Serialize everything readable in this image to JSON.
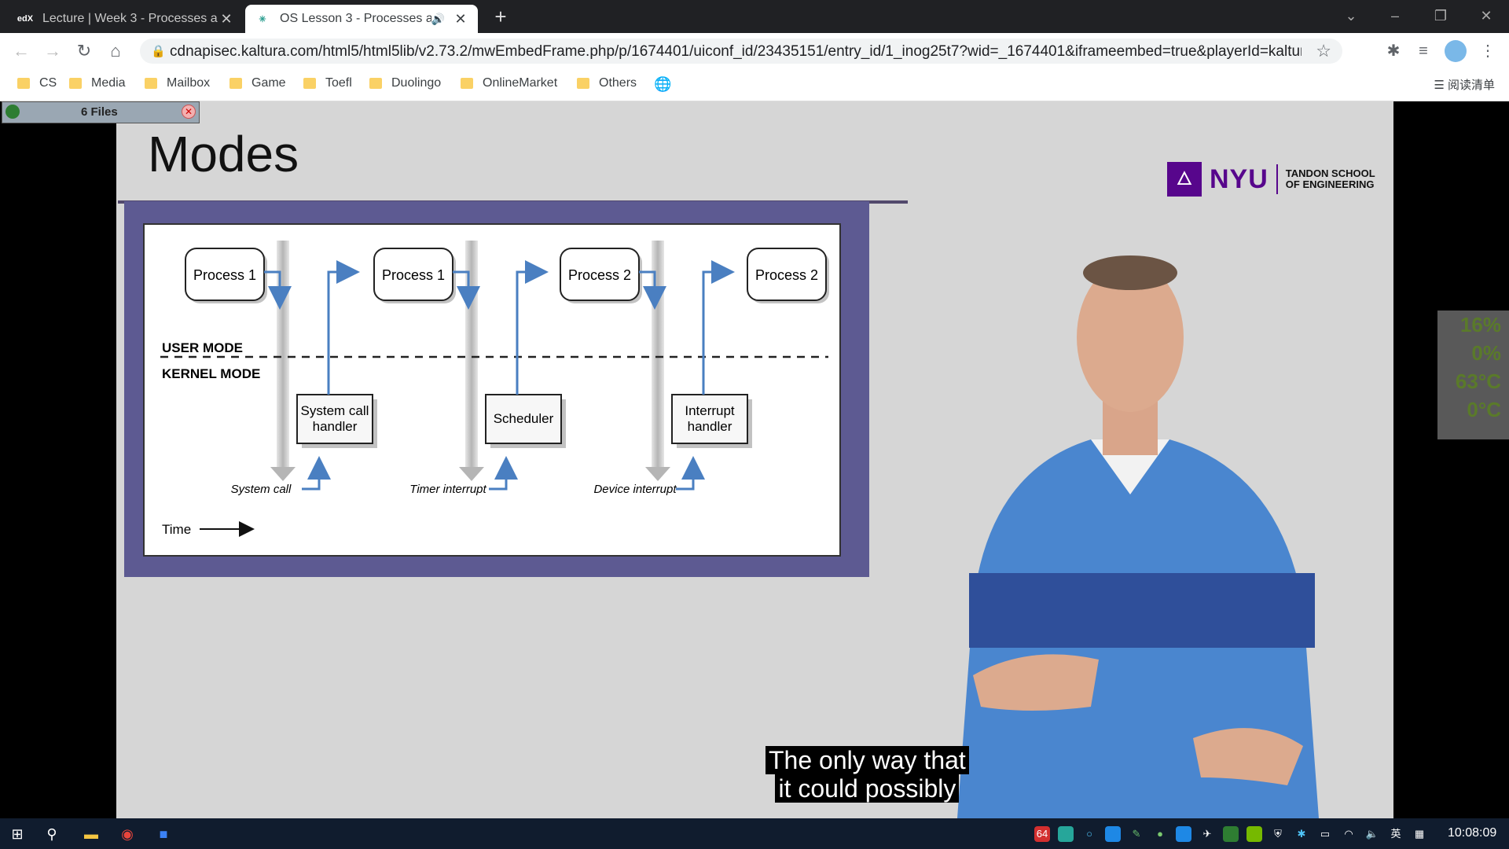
{
  "browser": {
    "tabs": [
      {
        "title": "Lecture | Week 3 - Processes a",
        "favicon": "edx-icon",
        "active": false
      },
      {
        "title": "OS Lesson 3 - Processes a",
        "favicon": "kaltura-icon",
        "active": true,
        "audio": true
      }
    ],
    "url": "cdnapisec.kaltura.com/html5/html5lib/v2.73.2/mwEmbedFrame.php/p/1674401/uiconf_id/23435151/entry_id/1_inog25t7?wid=_1674401&iframeembed=true&playerId=kaltur...",
    "bookmarks": [
      "CS",
      "Media",
      "Mailbox",
      "Game",
      "Toefl",
      "Duolingo",
      "OnlineMarket",
      "Others"
    ],
    "reading_list": "阅读清单"
  },
  "overlay": {
    "files_label": "6 Files"
  },
  "slide": {
    "title": "Modes",
    "logo": {
      "name": "NYU",
      "line1": "TANDON SCHOOL",
      "line2": "OF ENGINEERING"
    },
    "diagram": {
      "processes": [
        "Process 1",
        "Process 1",
        "Process 2",
        "Process 2"
      ],
      "mode_user": "USER MODE",
      "mode_kernel": "KERNEL MODE",
      "handlers": [
        [
          "System call",
          "handler"
        ],
        [
          "Scheduler"
        ],
        [
          "Interrupt",
          "handler"
        ]
      ],
      "events": [
        "System call",
        "Timer interrupt",
        "Device interrupt"
      ],
      "time_label": "Time"
    }
  },
  "caption": {
    "line1": "The only way that",
    "line2": "it could possibly"
  },
  "monitor": {
    "cpu": "16%",
    "gpu": "0%",
    "cpu_temp": "63°C",
    "gpu_temp": "0°C"
  },
  "taskbar": {
    "time": "10:08:09",
    "lang": "英",
    "badge": "64"
  },
  "colors": {
    "slide_bg": "#d6d6d6",
    "frame": "#5d5a92",
    "arrow": "#4a7fc1",
    "nyu_purple": "#57068c"
  }
}
